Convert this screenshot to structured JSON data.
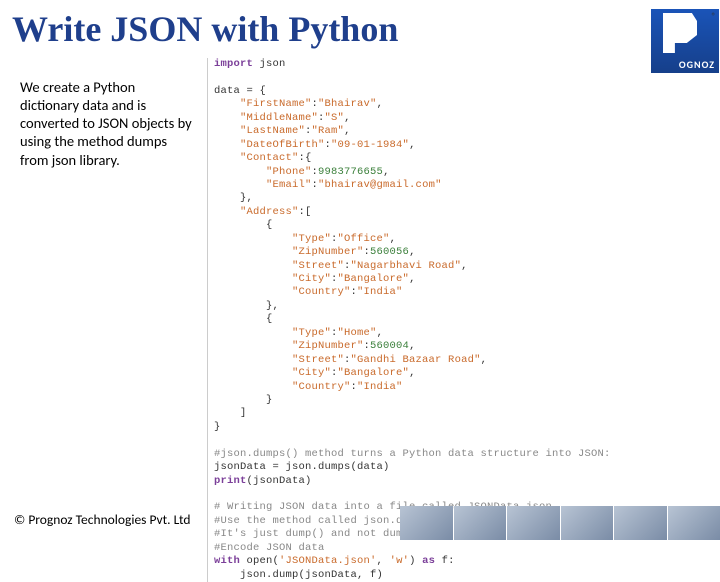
{
  "title": "Write JSON with Python",
  "left_text": "We create a Python dictionary data and is converted to JSON objects by using the method dumps from json library.",
  "code": {
    "l01a": "import",
    "l01b": " json",
    "l02": "",
    "l03": "data = {",
    "l04a": "    ",
    "l04s": "\"FirstName\"",
    "l04b": ":",
    "l04v": "\"Bhairav\"",
    "l04c": ",",
    "l05a": "    ",
    "l05s": "\"MiddleName\"",
    "l05b": ":",
    "l05v": "\"S\"",
    "l05c": ",",
    "l06a": "    ",
    "l06s": "\"LastName\"",
    "l06b": ":",
    "l06v": "\"Ram\"",
    "l06c": ",",
    "l07a": "    ",
    "l07s": "\"DateOfBirth\"",
    "l07b": ":",
    "l07v": "\"09-01-1984\"",
    "l07c": ",",
    "l08a": "    ",
    "l08s": "\"Contact\"",
    "l08b": ":{",
    "l09a": "        ",
    "l09s": "\"Phone\"",
    "l09b": ":",
    "l09v": "9983776655",
    "l09c": ",",
    "l10a": "        ",
    "l10s": "\"Email\"",
    "l10b": ":",
    "l10v": "\"bhairav@gmail.com\"",
    "l10c": "",
    "l11": "    },",
    "l12a": "    ",
    "l12s": "\"Address\"",
    "l12b": ":[",
    "l13": "        {",
    "l14a": "            ",
    "l14s": "\"Type\"",
    "l14b": ":",
    "l14v": "\"Office\"",
    "l14c": ",",
    "l15a": "            ",
    "l15s": "\"ZipNumber\"",
    "l15b": ":",
    "l15v": "560056",
    "l15c": ",",
    "l16a": "            ",
    "l16s": "\"Street\"",
    "l16b": ":",
    "l16v": "\"Nagarbhavi Road\"",
    "l16c": ",",
    "l17a": "            ",
    "l17s": "\"City\"",
    "l17b": ":",
    "l17v": "\"Bangalore\"",
    "l17c": ",",
    "l18a": "            ",
    "l18s": "\"Country\"",
    "l18b": ":",
    "l18v": "\"India\"",
    "l18c": "",
    "l19": "        },",
    "l20": "        {",
    "l21a": "            ",
    "l21s": "\"Type\"",
    "l21b": ":",
    "l21v": "\"Home\"",
    "l21c": ",",
    "l22a": "            ",
    "l22s": "\"ZipNumber\"",
    "l22b": ":",
    "l22v": "560004",
    "l22c": ",",
    "l23a": "            ",
    "l23s": "\"Street\"",
    "l23b": ":",
    "l23v": "\"Gandhi Bazaar Road\"",
    "l23c": ",",
    "l24a": "            ",
    "l24s": "\"City\"",
    "l24b": ":",
    "l24v": "\"Bangalore\"",
    "l24c": ",",
    "l25a": "            ",
    "l25s": "\"Country\"",
    "l25b": ":",
    "l25v": "\"India\"",
    "l25c": "",
    "l26": "        }",
    "l27": "    ]",
    "l28": "}",
    "l29": "",
    "l30": "#json.dumps() method turns a Python data structure into JSON:",
    "l31": "jsonData = json.dumps(data)",
    "l32a": "print",
    "l32b": "(jsonData)",
    "l33": "",
    "l34": "# Writing JSON data into a file called JSONData.json",
    "l35": "#Use the method called json.dump()",
    "l36": "#It's just dump() and not dumps()",
    "l37": "#Encode JSON data",
    "l38a": "with",
    "l38b": " open(",
    "l38s": "'JSONData.json'",
    "l38c": ", ",
    "l38s2": "'w'",
    "l38d": ") ",
    "l38e": "as",
    "l38f": " f:",
    "l39": "    json.dump(jsonData, f)"
  },
  "copyright": "© Prognoz Technologies Pvt. Ltd",
  "logo_text": "OGNOZ",
  "reg": "®"
}
